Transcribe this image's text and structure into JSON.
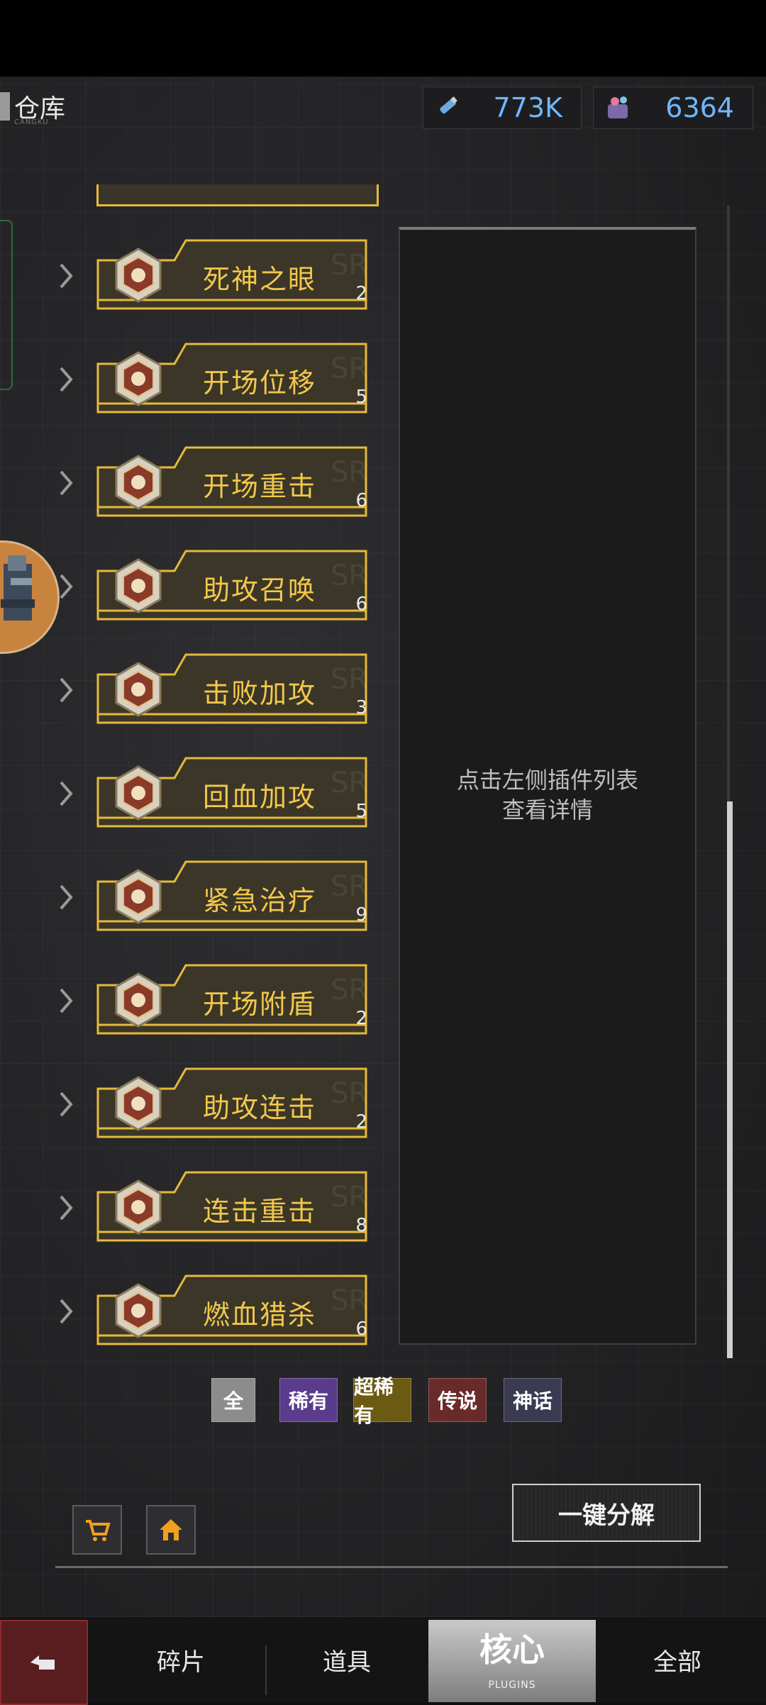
{
  "header": {
    "title": "仓库",
    "subtitle": "CANGKU",
    "resources": [
      {
        "icon": "potion-icon",
        "value": "773K"
      },
      {
        "icon": "gem-bag-icon",
        "value": "6364"
      }
    ]
  },
  "plugins": [
    {
      "name": "死神之眼",
      "count": "2",
      "emblem": "sword-emblem-icon"
    },
    {
      "name": "开场位移",
      "count": "5",
      "emblem": "runner-emblem-icon"
    },
    {
      "name": "开场重击",
      "count": "6",
      "emblem": "hammer-emblem-icon"
    },
    {
      "name": "助攻召唤",
      "count": "6",
      "emblem": "summon-emblem-icon"
    },
    {
      "name": "击败加攻",
      "count": "3",
      "emblem": "blade-emblem-icon"
    },
    {
      "name": "回血加攻",
      "count": "5",
      "emblem": "anchor-emblem-icon"
    },
    {
      "name": "紧急治疗",
      "count": "9",
      "emblem": "heart-emblem-icon"
    },
    {
      "name": "开场附盾",
      "count": "2",
      "emblem": "shield-emblem-icon"
    },
    {
      "name": "助攻连击",
      "count": "2",
      "emblem": "combo-emblem-icon"
    },
    {
      "name": "连击重击",
      "count": "8",
      "emblem": "building-emblem-icon"
    },
    {
      "name": "燃血猎杀",
      "count": "6",
      "emblem": "blood-emblem-icon"
    }
  ],
  "detail": {
    "hint_line1": "点击左侧插件列表",
    "hint_line2": "查看详情"
  },
  "filters": [
    {
      "label": "全",
      "color": "#8c8c8c"
    },
    {
      "label": "稀有",
      "color": "#5a3c8c"
    },
    {
      "label": "超稀有",
      "color": "#6b5a12"
    },
    {
      "label": "传说",
      "color": "#6b2a2a"
    },
    {
      "label": "神话",
      "color": "#3a3a52"
    }
  ],
  "actions": {
    "decompose": "一键分解",
    "shop_icon": "cart-icon",
    "home_icon": "home-icon"
  },
  "tabs": {
    "back_icon": "back-arrow-icon",
    "items": [
      {
        "label": "碎片"
      },
      {
        "label": "道具"
      },
      {
        "label": "核心",
        "sub": "PLUGINS"
      },
      {
        "label": "全部"
      }
    ]
  }
}
